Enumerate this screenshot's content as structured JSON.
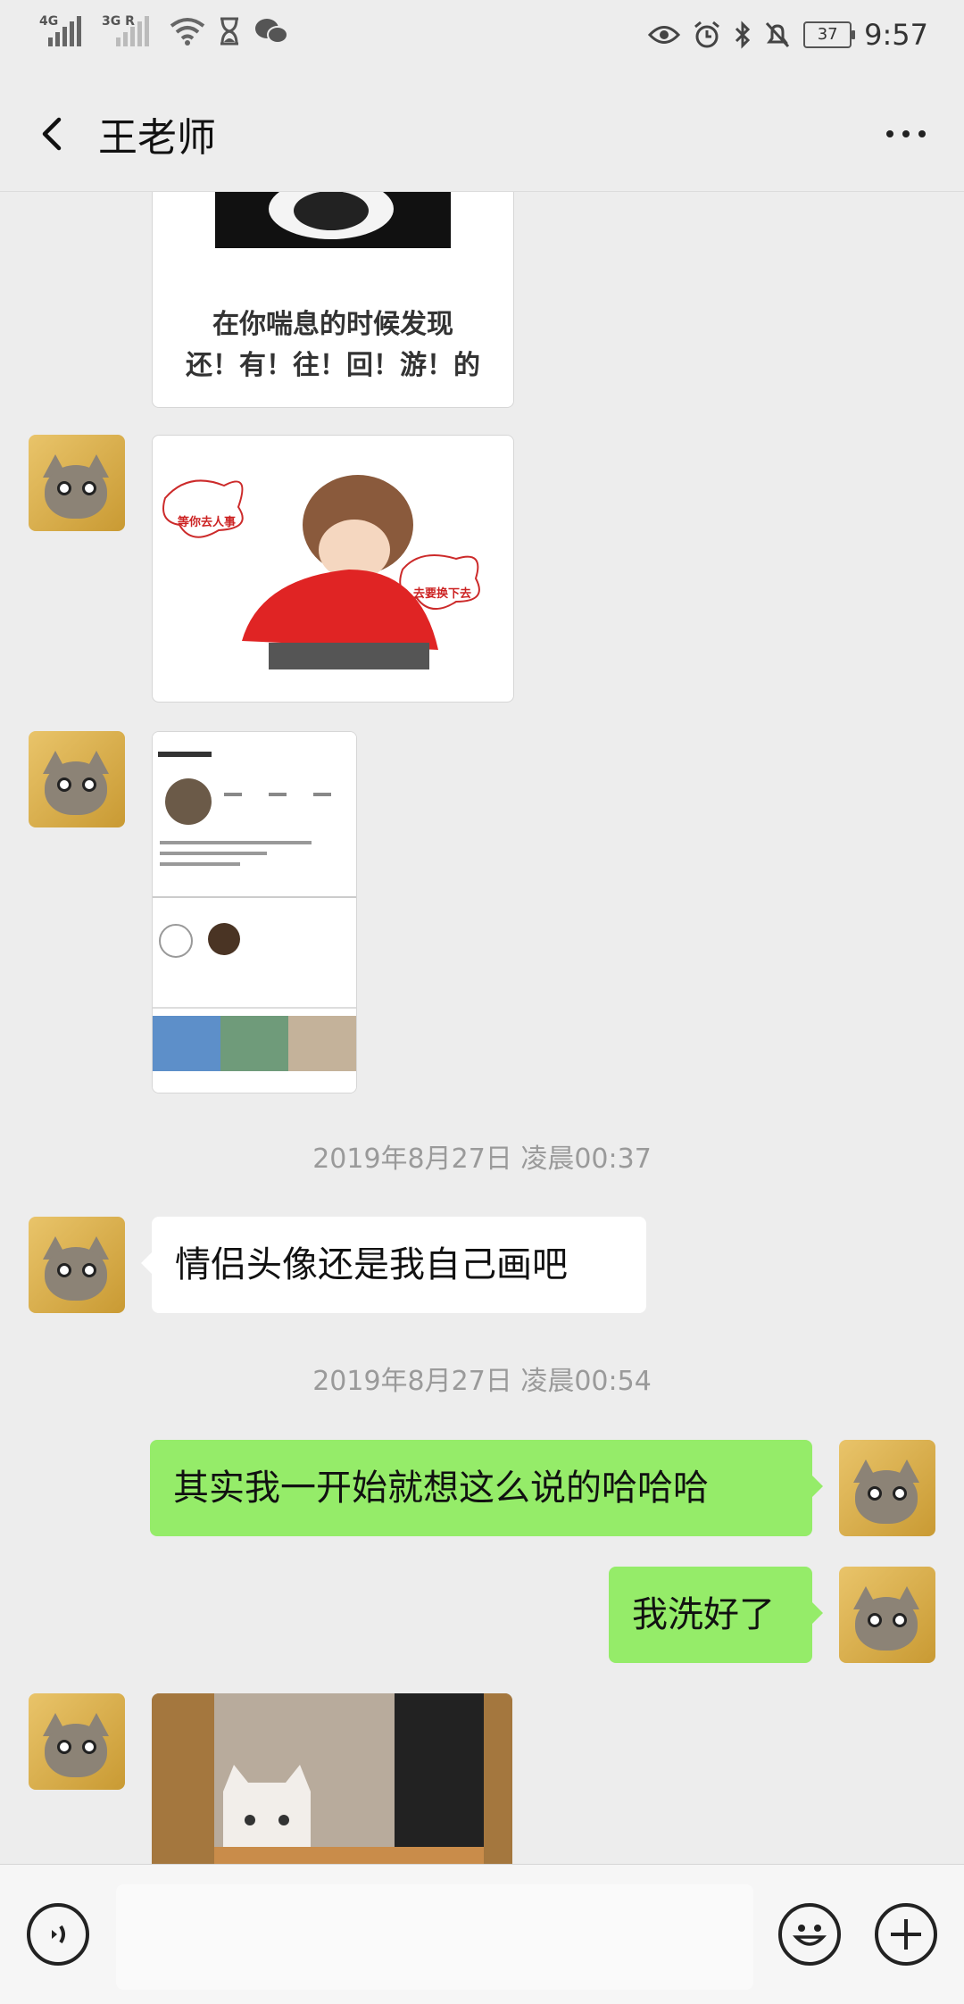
{
  "status_bar": {
    "signal1": "4G",
    "signal2": "3G R",
    "battery": "37",
    "time": "9:57"
  },
  "header": {
    "title": "王老师"
  },
  "messages": {
    "sticker1_caption_line1": "在你喘息的时候发现",
    "sticker1_caption_line2": "还！有！往！回！游！的",
    "sticker2_left_bubble": "等你去人事",
    "sticker2_right_bubble": "去要换下去",
    "timestamp1": "2019年8月27日 凌晨00:37",
    "text1": "情侣头像还是我自己画吧",
    "timestamp2": "2019年8月27日 凌晨00:54",
    "text2": "其实我一开始就想这么说的哈哈哈",
    "text3": "我洗好了"
  },
  "input": {
    "placeholder": ""
  }
}
